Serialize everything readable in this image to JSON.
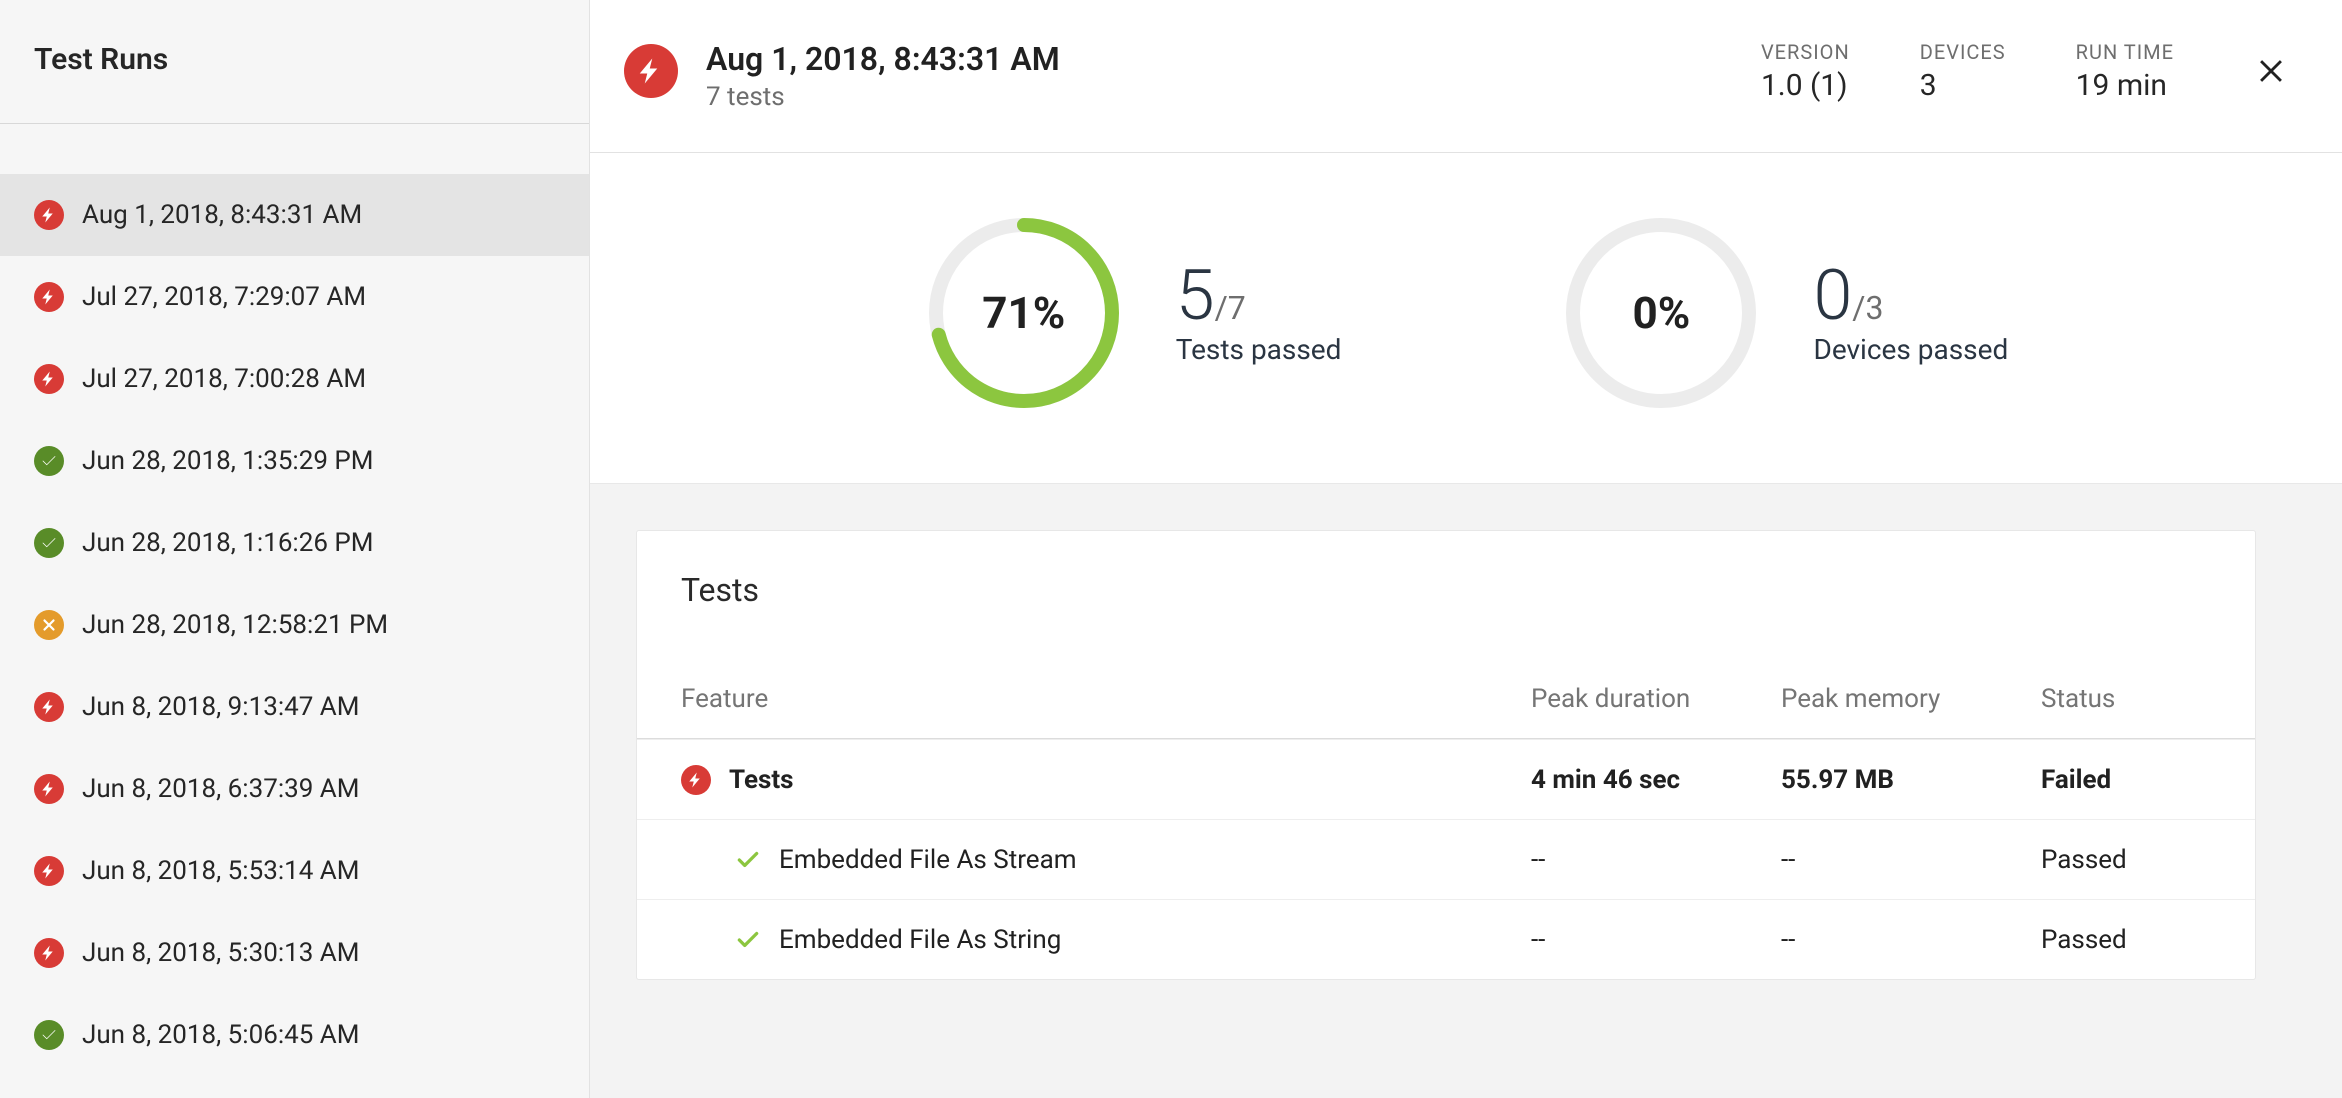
{
  "sidebar": {
    "title": "Test Runs",
    "runs": [
      {
        "label": "Aug 1, 2018, 8:43:31 AM",
        "status": "fail",
        "selected": true
      },
      {
        "label": "Jul 27, 2018, 7:29:07 AM",
        "status": "fail",
        "selected": false
      },
      {
        "label": "Jul 27, 2018, 7:00:28 AM",
        "status": "fail",
        "selected": false
      },
      {
        "label": "Jun 28, 2018, 1:35:29 PM",
        "status": "pass",
        "selected": false
      },
      {
        "label": "Jun 28, 2018, 1:16:26 PM",
        "status": "pass",
        "selected": false
      },
      {
        "label": "Jun 28, 2018, 12:58:21 PM",
        "status": "warn",
        "selected": false
      },
      {
        "label": "Jun 8, 2018, 9:13:47 AM",
        "status": "fail",
        "selected": false
      },
      {
        "label": "Jun 8, 2018, 6:37:39 AM",
        "status": "fail",
        "selected": false
      },
      {
        "label": "Jun 8, 2018, 5:53:14 AM",
        "status": "fail",
        "selected": false
      },
      {
        "label": "Jun 8, 2018, 5:30:13 AM",
        "status": "fail",
        "selected": false
      },
      {
        "label": "Jun 8, 2018, 5:06:45 AM",
        "status": "pass",
        "selected": false
      }
    ]
  },
  "header": {
    "title": "Aug 1, 2018, 8:43:31 AM",
    "subtitle": "7 tests",
    "meta": {
      "version_label": "VERSION",
      "version_value": "1.0 (1)",
      "devices_label": "DEVICES",
      "devices_value": "3",
      "runtime_label": "RUN TIME",
      "runtime_value": "19 min"
    }
  },
  "summary": {
    "tests": {
      "percent": 71,
      "percent_label": "71%",
      "passed": 5,
      "total": 7,
      "label": "Tests passed"
    },
    "devices": {
      "percent": 0,
      "percent_label": "0%",
      "passed": 0,
      "total": 3,
      "label": "Devices passed"
    }
  },
  "tests_card": {
    "title": "Tests",
    "columns": {
      "feature": "Feature",
      "duration": "Peak duration",
      "memory": "Peak memory",
      "status": "Status"
    },
    "rows": [
      {
        "kind": "group",
        "icon": "fail",
        "name": "Tests",
        "duration": "4 min 46 sec",
        "memory": "55.97 MB",
        "status": "Failed"
      },
      {
        "kind": "test",
        "icon": "pass",
        "name": "Embedded File As Stream",
        "duration": "--",
        "memory": "--",
        "status": "Passed"
      },
      {
        "kind": "test",
        "icon": "pass",
        "name": "Embedded File As String",
        "duration": "--",
        "memory": "--",
        "status": "Passed"
      }
    ]
  },
  "chart_data": [
    {
      "type": "pie",
      "title": "Tests passed",
      "categories": [
        "Passed",
        "Remaining"
      ],
      "values": [
        5,
        2
      ],
      "percent": 71,
      "ylim": [
        0,
        7
      ]
    },
    {
      "type": "pie",
      "title": "Devices passed",
      "categories": [
        "Passed",
        "Remaining"
      ],
      "values": [
        0,
        3
      ],
      "percent": 0,
      "ylim": [
        0,
        3
      ]
    }
  ]
}
